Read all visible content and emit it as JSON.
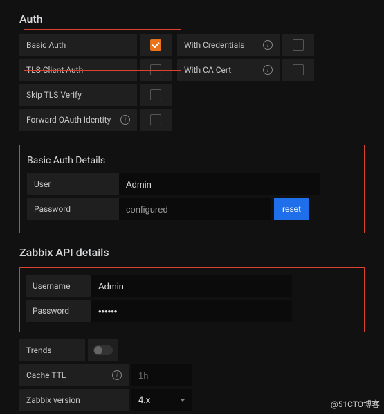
{
  "auth": {
    "title": "Auth",
    "basic_auth_label": "Basic Auth",
    "tls_client_label": "TLS Client Auth",
    "skip_tls_label": "Skip TLS Verify",
    "forward_oauth_label": "Forward OAuth Identity",
    "with_credentials_label": "With Credentials",
    "with_ca_cert_label": "With CA Cert",
    "basic_auth_checked": true,
    "tls_client_checked": false,
    "skip_tls_checked": false,
    "forward_oauth_checked": false,
    "with_credentials_checked": false,
    "with_ca_cert_checked": false
  },
  "basic_auth_details": {
    "title": "Basic Auth Details",
    "user_label": "User",
    "user_value": "Admin",
    "password_label": "Password",
    "password_value": "configured",
    "reset_label": "reset"
  },
  "zabbix": {
    "title": "Zabbix API details",
    "username_label": "Username",
    "username_value": "Admin",
    "password_label": "Password",
    "password_value": "••••••",
    "trends_label": "Trends",
    "cache_ttl_label": "Cache TTL",
    "cache_ttl_placeholder": "1h",
    "version_label": "Zabbix version",
    "version_value": "4.x"
  },
  "watermark": "@51CTO博客",
  "info_glyph": "i"
}
